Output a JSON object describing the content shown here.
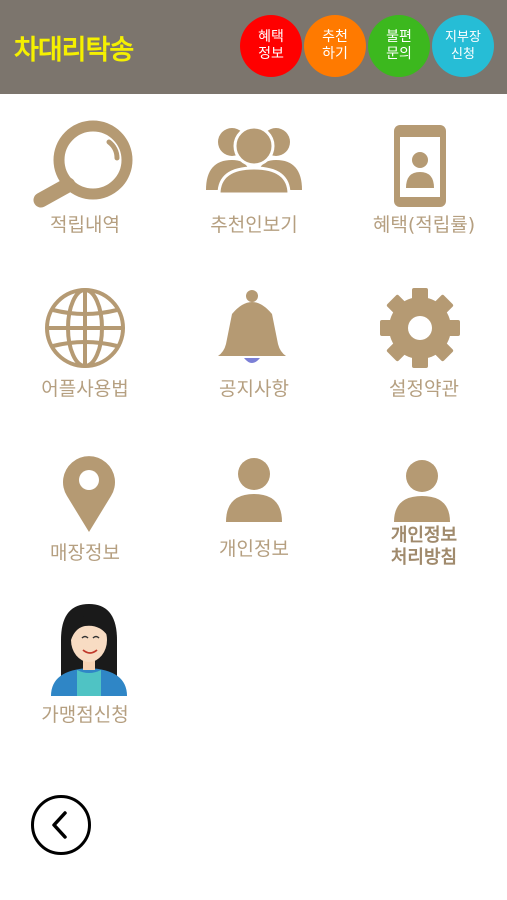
{
  "header": {
    "title": "차대리탁송",
    "buttons": [
      {
        "label": "혜택\n정보",
        "color": "#ff0000"
      },
      {
        "label": "추천\n하기",
        "color": "#ff7a00"
      },
      {
        "label": "불편\n문의",
        "color": "#3cb81e"
      },
      {
        "label": "지부장\n신청",
        "color": "#26bdd6"
      }
    ]
  },
  "menu": {
    "items": [
      {
        "label": "적립내역",
        "icon": "search-icon"
      },
      {
        "label": "추천인보기",
        "icon": "group-icon"
      },
      {
        "label": "혜택(적립률)",
        "icon": "phone-icon"
      },
      {
        "label": "어플사용법",
        "icon": "globe-icon"
      },
      {
        "label": "공지사항",
        "icon": "bell-icon"
      },
      {
        "label": "설정약관",
        "icon": "gear-icon"
      },
      {
        "label": "매장정보",
        "icon": "location-pin-icon"
      },
      {
        "label": "개인정보",
        "icon": "person-icon"
      },
      {
        "label": "개인정보\n처리방침",
        "icon": "person-icon"
      },
      {
        "label": "가맹점신청",
        "icon": "woman-avatar-icon"
      }
    ]
  },
  "colors": {
    "header_bg": "#7c756d",
    "title": "#f5f000",
    "icon": "#b59a73",
    "label": "#b59f80"
  }
}
